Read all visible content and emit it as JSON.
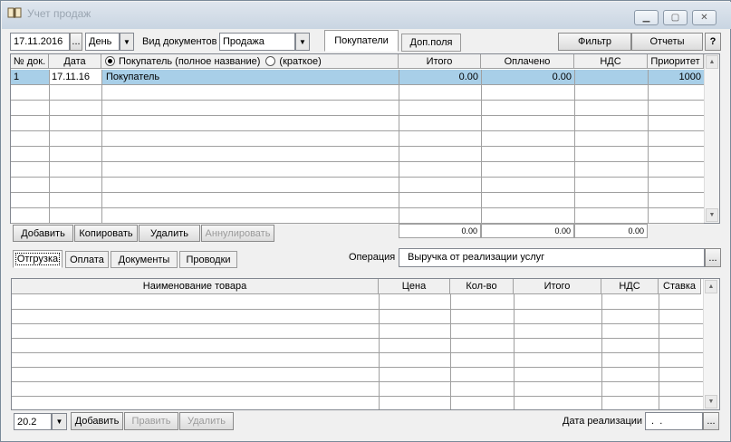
{
  "window": {
    "title": "Учет продаж",
    "min_icon": "minimize-icon",
    "max_icon": "maximize-icon",
    "close_icon": "close-icon"
  },
  "toolbar": {
    "date": "17.11.2016",
    "date_btn": "...",
    "period": "День",
    "doc_type_label": "Вид документов",
    "doc_type": "Продажа",
    "tab_buyers": "Покупатели",
    "tab_extra": "Доп.поля",
    "filter": "Фильтр",
    "reports": "Отчеты",
    "help": "?"
  },
  "docs": {
    "headers": {
      "num": "№ док.",
      "date": "Дата",
      "radio_full": "Покупатель (полное название)",
      "radio_short": "(краткое)",
      "total": "Итого",
      "paid": "Оплачено",
      "vat": "НДС",
      "priority": "Приоритет"
    },
    "rows": [
      {
        "num": "1",
        "date": "17.11.16",
        "buyer": "Покупатель",
        "total": "0.00",
        "paid": "0.00",
        "vat": "",
        "priority": "1000"
      }
    ],
    "totals": {
      "total": "0.00",
      "paid": "0.00",
      "vat": "0.00"
    },
    "buttons": {
      "add": "Добавить",
      "copy": "Копировать",
      "delete": "Удалить",
      "cancel": "Аннулировать"
    }
  },
  "lower_tabs": {
    "shipment": "Отгрузка",
    "payment": "Оплата",
    "documents": "Документы",
    "postings": "Проводки"
  },
  "operation": {
    "label": "Операция",
    "value": "Выручка от реализации услуг",
    "btn": "..."
  },
  "items": {
    "headers": {
      "name": "Наименование товара",
      "price": "Цена",
      "qty": "Кол-во",
      "total": "Итого",
      "vat": "НДС",
      "rate": "Ставка"
    }
  },
  "bottom": {
    "rate": "20.2",
    "add": "Добавить",
    "edit": "Править",
    "delete": "Удалить",
    "sale_date_label": "Дата реализации",
    "sale_date": " .  . ",
    "btn": "..."
  }
}
